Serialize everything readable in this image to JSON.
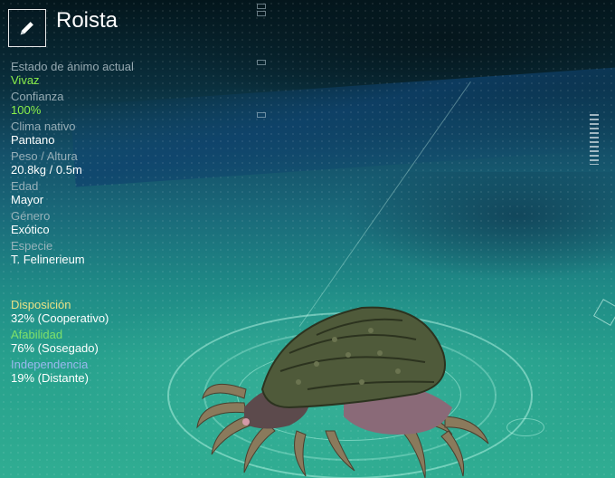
{
  "creature": {
    "name": "Roista",
    "edit_icon": "pencil-icon"
  },
  "stats": [
    {
      "label": "Estado de ánimo actual",
      "value": "Vivaz",
      "highlight": true
    },
    {
      "label": "Confianza",
      "value": "100%",
      "highlight": true
    },
    {
      "label": "Clima nativo",
      "value": "Pantano",
      "highlight": false
    },
    {
      "label": "Peso / Altura",
      "value": "20.8kg / 0.5m",
      "highlight": false
    },
    {
      "label": "Edad",
      "value": "Mayor",
      "highlight": false
    },
    {
      "label": "Género",
      "value": "Exótico",
      "highlight": false
    },
    {
      "label": "Especie",
      "value": "T. Felinerieum",
      "highlight": false
    }
  ],
  "traits": [
    {
      "label": "Disposición",
      "value": "32% (Cooperativo)",
      "color": "#e9e186"
    },
    {
      "label": "Afabilidad",
      "value": "76% (Sosegado)",
      "color": "#7ee06a"
    },
    {
      "label": "Independencia",
      "value": "19% (Distante)",
      "color": "#9ab8ef"
    }
  ],
  "colors": {
    "highlight_green": "#8af04a",
    "label_gray": "#aebfc6"
  }
}
